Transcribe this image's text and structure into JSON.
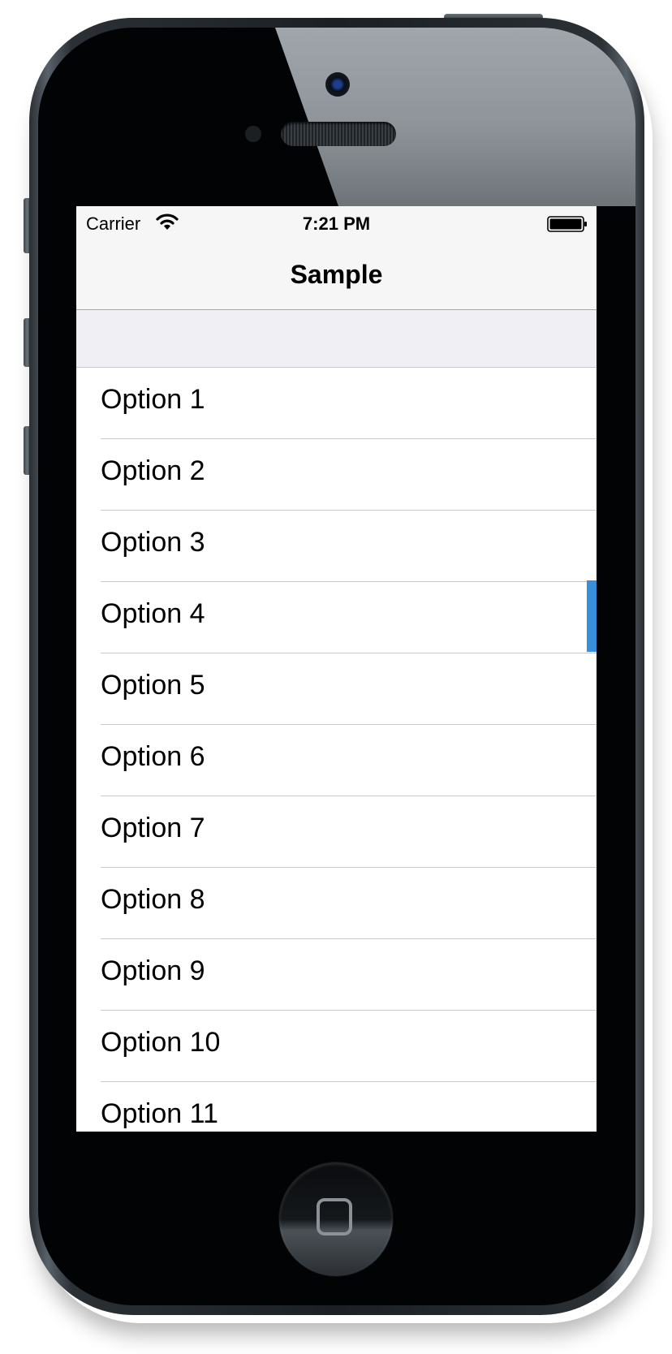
{
  "status_bar": {
    "carrier": "Carrier",
    "time": "7:21 PM",
    "wifi_icon": "wifi-icon",
    "battery_icon": "battery-icon"
  },
  "nav": {
    "title": "Sample"
  },
  "list": {
    "items": [
      {
        "label": "Option 1"
      },
      {
        "label": "Option 2"
      },
      {
        "label": "Option 3"
      },
      {
        "label": "Option 4"
      },
      {
        "label": "Option 5"
      },
      {
        "label": "Option 6"
      },
      {
        "label": "Option 7"
      },
      {
        "label": "Option 8"
      },
      {
        "label": "Option 9"
      },
      {
        "label": "Option 10"
      },
      {
        "label": "Option 11"
      }
    ]
  },
  "colors": {
    "scroll_indicator": "#3a8fdb",
    "nav_background": "#f6f6f7",
    "section_background": "#efeff4"
  },
  "device": {
    "home_button_icon": "home-button-icon"
  }
}
